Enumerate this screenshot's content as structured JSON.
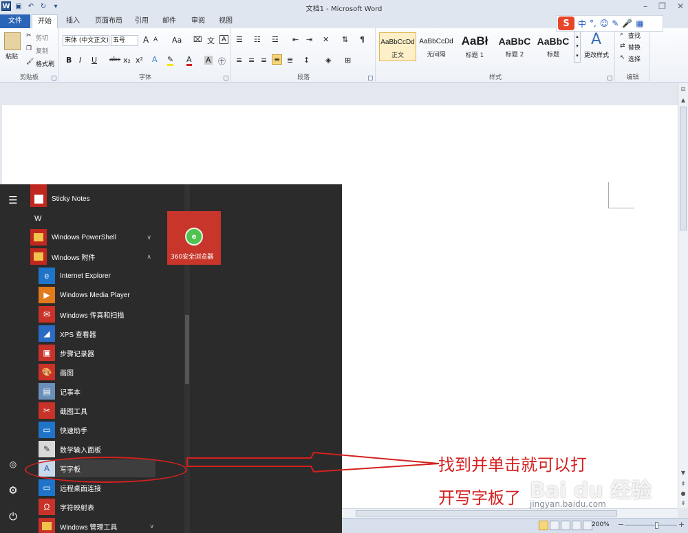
{
  "window": {
    "title": "文档1 - Microsoft Word",
    "qat_icons": [
      "word-app-icon",
      "save-icon",
      "undo-icon",
      "redo-icon",
      "customize-icon"
    ],
    "controls": {
      "minimize": "–",
      "restore": "❐",
      "close": "✕"
    }
  },
  "tabs": [
    "文件",
    "开始",
    "插入",
    "页面布局",
    "引用",
    "邮件",
    "审阅",
    "视图"
  ],
  "ime": {
    "logo": "S",
    "items": [
      "中",
      "°,",
      "☺",
      "✎",
      "🎤",
      "▦",
      "⚙"
    ]
  },
  "ribbon": {
    "clipboard": {
      "label": "剪贴板",
      "paste": "粘贴",
      "cut": "剪切",
      "copy": "复制",
      "format_painter": "格式刷"
    },
    "font": {
      "label": "字体",
      "font_name": "宋体 (中文正文)",
      "font_size": "五号",
      "grow": "A",
      "shrink": "A",
      "change_case": "Aa",
      "bold": "B",
      "italic": "I",
      "underline": "U",
      "strike": "abc",
      "subscript": "x₂",
      "superscript": "x²"
    },
    "paragraph": {
      "label": "段落"
    },
    "styles": {
      "label": "样式",
      "items": [
        {
          "sample": "AaBbCcDd",
          "name": "正文"
        },
        {
          "sample": "AaBbCcDd",
          "name": "无间隔"
        },
        {
          "sample": "AaBł",
          "name": "标题 1"
        },
        {
          "sample": "AaBbC",
          "name": "标题 2"
        },
        {
          "sample": "AaBbC",
          "name": "标题"
        }
      ],
      "change_styles": "更改样式"
    },
    "editing": {
      "label": "编辑",
      "find": "查找",
      "replace": "替换",
      "select": "选择"
    }
  },
  "statusbar": {
    "zoom": "200%",
    "zoom_fraction": 0.62
  },
  "start_menu": {
    "letter": "W",
    "apps": [
      {
        "label": "Sticky Notes",
        "icon": "sticky-notes-icon"
      },
      {
        "label": "Windows PowerShell",
        "icon": "folder-icon"
      },
      {
        "label": "Windows 附件",
        "icon": "folder-icon"
      }
    ],
    "accessories": [
      {
        "label": "Internet Explorer",
        "icon": "ie-icon"
      },
      {
        "label": "Windows Media Player",
        "icon": "media-player-icon"
      },
      {
        "label": "Windows 传真和扫描",
        "icon": "fax-scan-icon"
      },
      {
        "label": "XPS 查看器",
        "icon": "xps-viewer-icon"
      },
      {
        "label": "步骤记录器",
        "icon": "steps-recorder-icon"
      },
      {
        "label": "画图",
        "icon": "paint-icon"
      },
      {
        "label": "记事本",
        "icon": "notepad-icon"
      },
      {
        "label": "截图工具",
        "icon": "snipping-tool-icon"
      },
      {
        "label": "快速助手",
        "icon": "quick-assist-icon"
      },
      {
        "label": "数学输入面板",
        "icon": "math-input-icon"
      },
      {
        "label": "写字板",
        "icon": "wordpad-icon"
      },
      {
        "label": "远程桌面连接",
        "icon": "remote-desktop-icon"
      },
      {
        "label": "字符映射表",
        "icon": "charmap-icon"
      }
    ],
    "bottom_partial": "Windows 管理工具",
    "tile": {
      "label": "360安全浏览器"
    }
  },
  "annotation": {
    "line1": "找到并单击就可以打",
    "line2": "开写字板了"
  },
  "watermark": {
    "logo": "Bai du 经验",
    "url": "jingyan.baidu.com"
  }
}
